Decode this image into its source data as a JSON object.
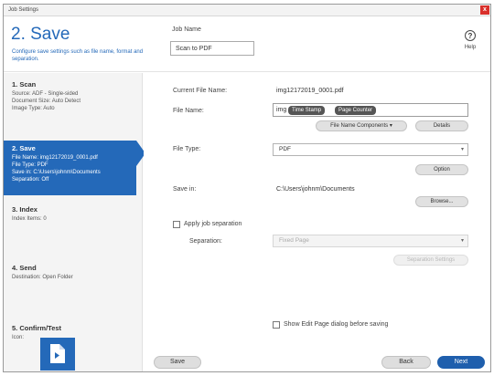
{
  "window": {
    "title": "Job Settings",
    "close_glyph": "x"
  },
  "header": {
    "step_title": "2. Save",
    "step_desc": "Configure save settings such as file name, format and separation.",
    "job_name_label": "Job Name",
    "job_name_value": "Scan to PDF",
    "help_label": "Help",
    "help_glyph": "?"
  },
  "sidebar": {
    "steps": [
      {
        "name": "1. Scan",
        "info": [
          "Source: ADF - Single-sided",
          "Document Size: Auto Detect",
          "Image Type: Auto"
        ]
      },
      {
        "name": "2. Save",
        "info": [
          "File Name: img12172019_0001.pdf",
          "File Type: PDF",
          "Save in: C:\\Users\\johnm\\Documents",
          "Separation: Off"
        ]
      },
      {
        "name": "3. Index",
        "info": [
          "Index Items: 0"
        ]
      },
      {
        "name": "4. Send",
        "info": [
          "Destination: Open Folder"
        ]
      },
      {
        "name": "5. Confirm/Test",
        "info": [
          "Icon:"
        ]
      }
    ]
  },
  "main": {
    "current_file_label": "Current File Name:",
    "current_file_value": "img12172019_0001.pdf",
    "file_name_label": "File Name:",
    "file_name_prefix": "img",
    "tag_time_stamp": "Time Stamp",
    "tag_page_counter": "Page Counter",
    "file_name_components_btn": "File Name Components",
    "details_btn": "Details",
    "file_type_label": "File Type:",
    "file_type_value": "PDF",
    "option_btn": "Option",
    "save_in_label": "Save in:",
    "save_in_value": "C:\\Users\\johnm\\Documents",
    "browse_btn": "Browse...",
    "apply_separation_label": "Apply job separation",
    "separation_label": "Separation:",
    "separation_value": "Fixed Page",
    "separation_settings_btn": "Separation Settings",
    "show_edit_page_label": "Show Edit Page dialog before saving"
  },
  "footer": {
    "save_btn": "Save",
    "back_btn": "Back",
    "next_btn": "Next"
  },
  "colors": {
    "accent": "#2469b9",
    "close": "#d9302b"
  }
}
